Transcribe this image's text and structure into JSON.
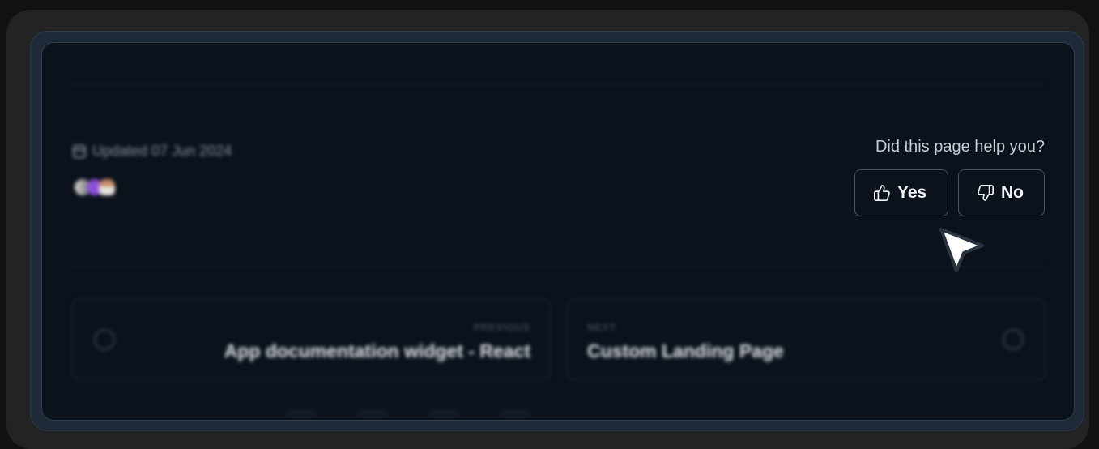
{
  "meta": {
    "updated_text": "Updated 07 Jun 2024"
  },
  "feedback": {
    "question": "Did this page help you?",
    "yes_label": "Yes",
    "no_label": "No"
  },
  "navigation": {
    "previous": {
      "kicker": "PREVIOUS",
      "title": "App documentation widget - React"
    },
    "next": {
      "kicker": "NEXT",
      "title": "Custom Landing Page"
    }
  },
  "icons": {
    "calendar": "calendar-icon",
    "thumbs_up": "thumbs-up-icon",
    "thumbs_down": "thumbs-down-icon",
    "arrow_left": "arrow-left-circle-icon",
    "arrow_right": "arrow-right-circle-icon",
    "cursor": "mouse-pointer-icon"
  },
  "colors": {
    "panel_bg": "#0b121c",
    "panel_border": "#2f3d50",
    "button_border": "#4a5563",
    "text_primary": "#f1f3f5",
    "text_muted": "#8a929c"
  }
}
